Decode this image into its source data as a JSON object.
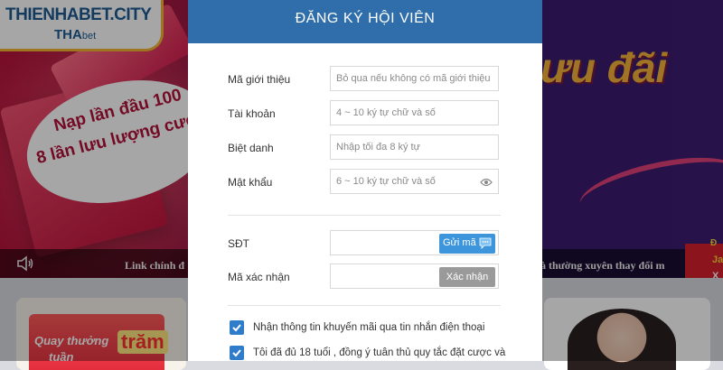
{
  "brand": {
    "logo_main": "THIENHABET.CITY",
    "logo_sub_1": "THA",
    "logo_sub_2": "bet"
  },
  "banner": {
    "callout_line1": "Nạp lần đầu 100",
    "callout_line2": "8 lần lưu lượng cược",
    "promo_title": "ưu đãi",
    "marquee_left": "Link chính đ",
    "marquee_right": "à thường xuyên thay đổi m",
    "corner_line1": "Đ",
    "corner_line2": "Ja",
    "corner_line3": "X"
  },
  "cards": {
    "left_line1": "Quay thưởng",
    "left_line2": "tuần",
    "left_badge": "trăm"
  },
  "modal": {
    "title": "ĐĂNG KÝ HỘI VIÊN",
    "fields": {
      "referral": {
        "label": "Mã giới thiệu",
        "placeholder": "Bỏ qua nếu không có mã giới thiệu"
      },
      "account": {
        "label": "Tài khoản",
        "placeholder": "4 ~ 10 ký tự chữ và số"
      },
      "nickname": {
        "label": "Biệt danh",
        "placeholder": "Nhập tối đa 8 ký tự"
      },
      "password": {
        "label": "Mật khẩu",
        "placeholder": "6 ~ 10 ký tự chữ và số"
      },
      "phone": {
        "label": "SĐT",
        "placeholder": "",
        "button": "Gửi mã"
      },
      "verify": {
        "label": "Mã xác nhận",
        "placeholder": "",
        "button": "Xác nhận"
      }
    },
    "checkboxes": [
      {
        "label": "Nhận thông tin khuyến mãi qua tin nhắn điện thoại",
        "checked": true
      },
      {
        "label": "Tôi đã đủ 18 tuổi , đồng ý tuân thủ quy tắc đặt cược và",
        "checked": true
      }
    ]
  },
  "colors": {
    "header_blue": "#2f6eaa",
    "accent_blue": "#3d96dc",
    "checkbox_blue": "#2f7ccb",
    "button_gray": "#9a9a9a"
  },
  "icons": [
    "close-icon",
    "eye-icon",
    "chat-icon",
    "check-icon",
    "speaker-icon"
  ]
}
